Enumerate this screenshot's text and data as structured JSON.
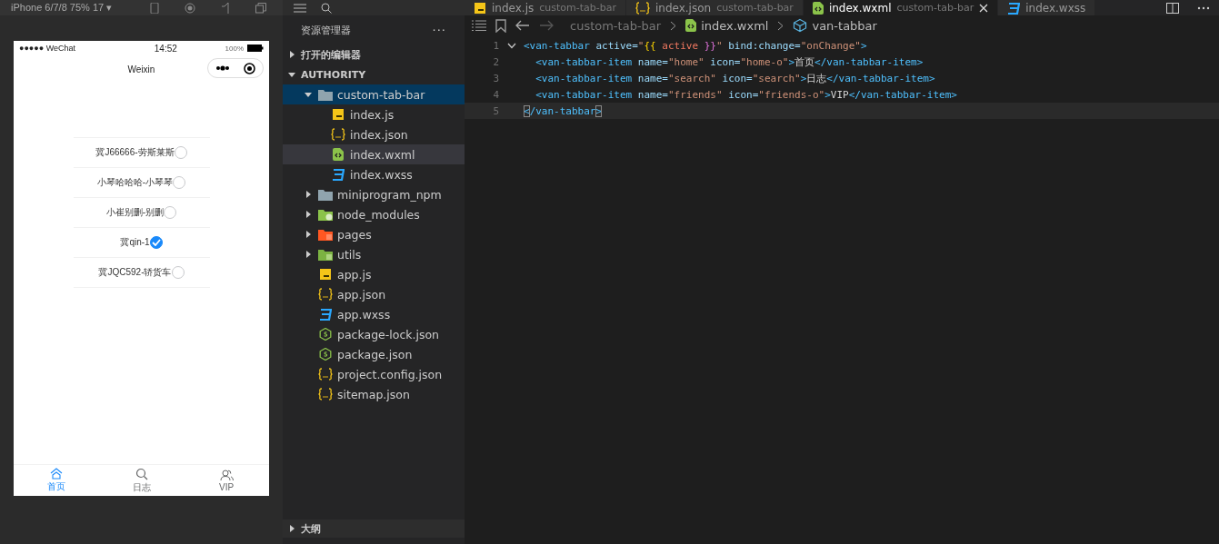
{
  "simulator": {
    "device": "iPhone 6/7/8 75% 17 ▾",
    "status_bar": {
      "carrier": "●●●●● WeChat",
      "time": "14:52",
      "battery": "100%"
    },
    "nav_title": "Weixin",
    "list": [
      {
        "label": "冀J66666-劳斯莱斯",
        "checked": false
      },
      {
        "label": "小琴哈哈哈-小琴琴",
        "checked": false
      },
      {
        "label": "小崔别删-别删",
        "checked": false
      },
      {
        "label": "冀qin-1",
        "checked": true
      },
      {
        "label": "冀JQC592-轿货车",
        "checked": false
      }
    ],
    "tabbar": [
      {
        "label": "首页",
        "kind": "home",
        "selected": true
      },
      {
        "label": "日志",
        "kind": "search",
        "selected": false
      },
      {
        "label": "VIP",
        "kind": "friends",
        "selected": false
      }
    ]
  },
  "explorer": {
    "title": "资源管理器",
    "more": "···",
    "sections": [
      {
        "label": "打开的编辑器",
        "expanded": false
      },
      {
        "label": "AUTHORITY",
        "expanded": true
      }
    ],
    "tree": [
      {
        "label": "custom-tab-bar",
        "kind": "folder",
        "expanded": true,
        "focused": true,
        "selected": false,
        "children": [
          {
            "label": "index.js",
            "kind": "js",
            "focused": false,
            "selected": false
          },
          {
            "label": "index.json",
            "kind": "json",
            "focused": false,
            "selected": false
          },
          {
            "label": "index.wxml",
            "kind": "wxml",
            "focused": false,
            "selected": true
          },
          {
            "label": "index.wxss",
            "kind": "wxss",
            "focused": false,
            "selected": false
          }
        ]
      },
      {
        "label": "miniprogram_npm",
        "kind": "folder",
        "expanded": false,
        "focused": false,
        "selected": false
      },
      {
        "label": "node_modules",
        "kind": "folder-node",
        "expanded": false,
        "focused": false,
        "selected": false
      },
      {
        "label": "pages",
        "kind": "folder-pages",
        "expanded": false,
        "focused": false,
        "selected": false
      },
      {
        "label": "utils",
        "kind": "folder-utils",
        "expanded": false,
        "focused": false,
        "selected": false
      },
      {
        "label": "app.js",
        "kind": "js",
        "focused": false,
        "selected": false
      },
      {
        "label": "app.json",
        "kind": "json",
        "focused": false,
        "selected": false
      },
      {
        "label": "app.wxss",
        "kind": "wxss",
        "focused": false,
        "selected": false
      },
      {
        "label": "package-lock.json",
        "kind": "node",
        "focused": false,
        "selected": false
      },
      {
        "label": "package.json",
        "kind": "node",
        "focused": false,
        "selected": false
      },
      {
        "label": "project.config.json",
        "kind": "json",
        "focused": false,
        "selected": false
      },
      {
        "label": "sitemap.json",
        "kind": "json",
        "focused": false,
        "selected": false
      }
    ],
    "outline": {
      "label": "大纲",
      "expanded": false
    }
  },
  "tabs": [
    {
      "name": "index.js",
      "dir": "custom-tab-bar",
      "kind": "js",
      "selected": false
    },
    {
      "name": "index.json",
      "dir": "custom-tab-bar",
      "kind": "json",
      "selected": false
    },
    {
      "name": "index.wxml",
      "dir": "custom-tab-bar",
      "kind": "wxml",
      "selected": true
    },
    {
      "name": "index.wxss",
      "kind": "wxss",
      "selected": false
    }
  ],
  "breadcrumb": [
    {
      "label": "custom-tab-bar",
      "kind": "folder"
    },
    {
      "label": "index.wxml",
      "kind": "wxml"
    },
    {
      "label": "van-tabbar",
      "kind": "cube"
    }
  ],
  "code": [
    {
      "number": "1",
      "current": false,
      "tokens": [
        {
          "text": "<van-tabbar",
          "kind": "tag"
        },
        {
          "text": " active=",
          "kind": "attr"
        },
        {
          "text": "\"",
          "kind": "str"
        },
        {
          "text": "{{",
          "kind": "brace"
        },
        {
          "text": " active ",
          "kind": "var"
        },
        {
          "text": "}}",
          "kind": "brace2"
        },
        {
          "text": "\"",
          "kind": "str"
        },
        {
          "text": " bind:change=",
          "kind": "attr"
        },
        {
          "text": "\"onChange\"",
          "kind": "str"
        },
        {
          "text": ">",
          "kind": "tag"
        }
      ]
    },
    {
      "number": "2",
      "current": false,
      "tokens": [
        {
          "text": "  <van-tabbar-item",
          "kind": "tag"
        },
        {
          "text": " name=",
          "kind": "attr"
        },
        {
          "text": "\"home\"",
          "kind": "str"
        },
        {
          "text": " icon=",
          "kind": "attr"
        },
        {
          "text": "\"home-o\"",
          "kind": "str"
        },
        {
          "text": ">",
          "kind": "tag"
        },
        {
          "text": "首页",
          "kind": "text"
        },
        {
          "text": "</van-tabbar-item>",
          "kind": "tag"
        }
      ]
    },
    {
      "number": "3",
      "current": false,
      "tokens": [
        {
          "text": "  <van-tabbar-item",
          "kind": "tag"
        },
        {
          "text": " name=",
          "kind": "attr"
        },
        {
          "text": "\"search\"",
          "kind": "str"
        },
        {
          "text": " icon=",
          "kind": "attr"
        },
        {
          "text": "\"search\"",
          "kind": "str"
        },
        {
          "text": ">",
          "kind": "tag"
        },
        {
          "text": "日志",
          "kind": "text"
        },
        {
          "text": "</van-tabbar-item>",
          "kind": "tag"
        }
      ]
    },
    {
      "number": "4",
      "current": false,
      "tokens": [
        {
          "text": "  <van-tabbar-item",
          "kind": "tag"
        },
        {
          "text": " name=",
          "kind": "attr"
        },
        {
          "text": "\"friends\"",
          "kind": "str"
        },
        {
          "text": " icon=",
          "kind": "attr"
        },
        {
          "text": "\"friends-o\"",
          "kind": "str"
        },
        {
          "text": ">",
          "kind": "tag"
        },
        {
          "text": "VIP",
          "kind": "text"
        },
        {
          "text": "</van-tabbar-item>",
          "kind": "tag"
        }
      ]
    },
    {
      "number": "5",
      "current": true,
      "tokens": [
        {
          "text": "<",
          "kind": "match"
        },
        {
          "text": "/van-tabbar",
          "kind": "tag"
        },
        {
          "text": ">",
          "kind": "match"
        }
      ]
    }
  ]
}
